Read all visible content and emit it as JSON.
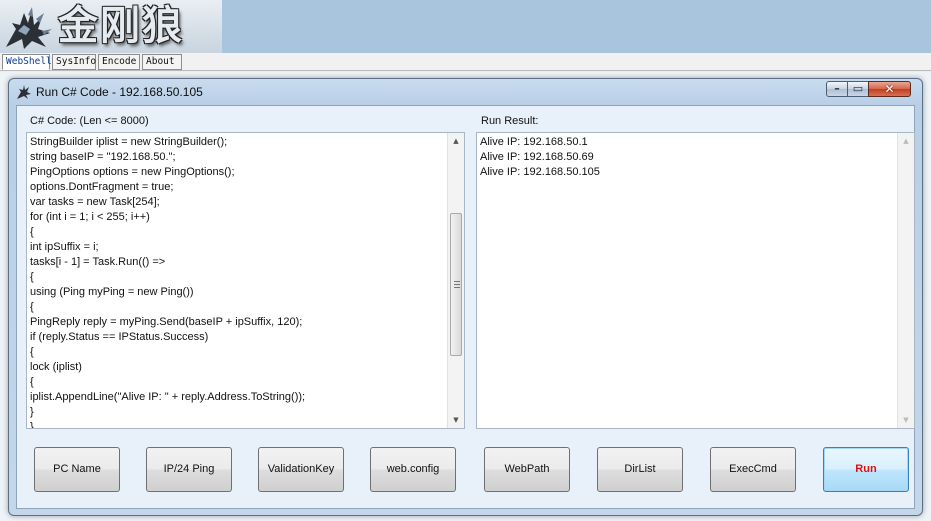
{
  "header": {
    "brand_text": "金刚狼",
    "logo_icon": "wolverine-claw-icon"
  },
  "tabs": [
    {
      "label": "WebShell",
      "active": true
    },
    {
      "label": "SysInfo",
      "active": false
    },
    {
      "label": "Encode",
      "active": false
    },
    {
      "label": "About",
      "active": false
    }
  ],
  "dialog": {
    "title": "Run C# Code - 192.168.50.105",
    "window_controls": {
      "minimize": "–",
      "maximize": "▭",
      "close": "✕"
    },
    "code_label": "C# Code: (Len <= 8000)",
    "result_label": "Run Result:",
    "code_lines": [
      "StringBuilder iplist = new StringBuilder();",
      "string baseIP = \"192.168.50.\";",
      "PingOptions options = new PingOptions();",
      "options.DontFragment = true;",
      "var tasks = new Task[254];",
      "for (int i = 1; i < 255; i++)",
      "{",
      "int ipSuffix = i;",
      "tasks[i - 1] = Task.Run(() =>",
      "{",
      "using (Ping myPing = new Ping())",
      "{",
      "PingReply reply = myPing.Send(baseIP + ipSuffix, 120);",
      "if (reply.Status == IPStatus.Success)",
      "{",
      "lock (iplist)",
      "{",
      "iplist.AppendLine(\"Alive IP: \" + reply.Address.ToString());",
      "}",
      "}"
    ],
    "result_lines": [
      "Alive IP: 192.168.50.1",
      "Alive IP: 192.168.50.69",
      "Alive IP: 192.168.50.105"
    ],
    "buttons": [
      {
        "name": "pc-name-button",
        "label": "PC Name"
      },
      {
        "name": "ip24-ping-button",
        "label": "IP/24 Ping"
      },
      {
        "name": "validation-key-button",
        "label": "ValidationKey"
      },
      {
        "name": "web-config-button",
        "label": "web.config"
      },
      {
        "name": "webpath-button",
        "label": "WebPath"
      },
      {
        "name": "dirlist-button",
        "label": "DirList"
      },
      {
        "name": "execcmd-button",
        "label": "ExecCmd"
      },
      {
        "name": "run-button",
        "label": "Run"
      }
    ]
  },
  "colors": {
    "run_text": "#e01010",
    "header_bg": "#a9c4dd",
    "dialog_frame": "#c4d7ea"
  }
}
